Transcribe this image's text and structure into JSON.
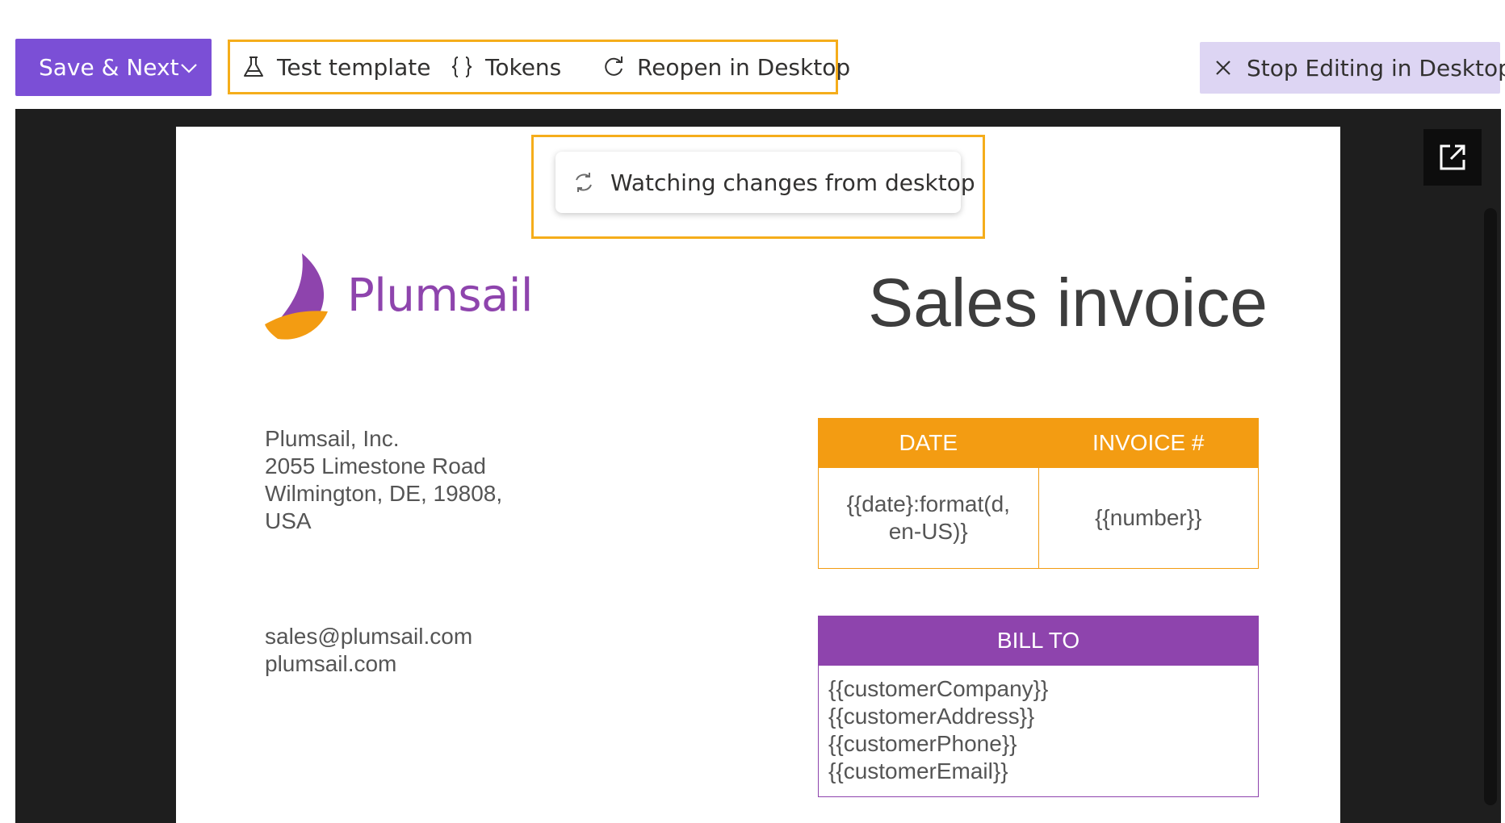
{
  "toolbar": {
    "save_label": "Save & Next",
    "test_label": "Test template",
    "tokens_label": "Tokens",
    "reopen_label": "Reopen in Desktop",
    "stop_label": "Stop Editing in Desktop"
  },
  "status": {
    "watching_label": "Watching changes from desktop"
  },
  "document": {
    "brand": "Plumsail",
    "title": "Sales invoice",
    "address": [
      "Plumsail, Inc.",
      "2055 Limestone Road",
      "Wilmington, DE, 19808,",
      "USA"
    ],
    "contact": [
      "sales@plumsail.com",
      "plumsail.com"
    ],
    "invoice_table": {
      "date_header": "DATE",
      "number_header": "INVOICE #",
      "date_value_line1": "{{date}:format(d,",
      "date_value_line2": "en-US)}",
      "number_value": "{{number}}"
    },
    "bill_to": {
      "header": "BILL TO",
      "lines": [
        "{{customerCompany}}",
        "{{customerAddress}}",
        "{{customerPhone}}",
        "{{customerEmail}}"
      ]
    }
  },
  "colors": {
    "primary": "#7b4fd6",
    "highlight": "#f5ad1b",
    "orange": "#f39c12",
    "purple": "#8e44ad",
    "stop_bg": "#ddd5f3",
    "viewer_bg": "#1e1e1e"
  },
  "icons": {
    "save_dropdown": "chevron-down-icon",
    "test": "beaker-icon",
    "tokens": "braces-icon",
    "reopen": "refresh-icon",
    "stop": "close-icon",
    "watching": "sync-icon",
    "popout": "open-in-new-icon",
    "logo": "sail-logo-icon"
  }
}
